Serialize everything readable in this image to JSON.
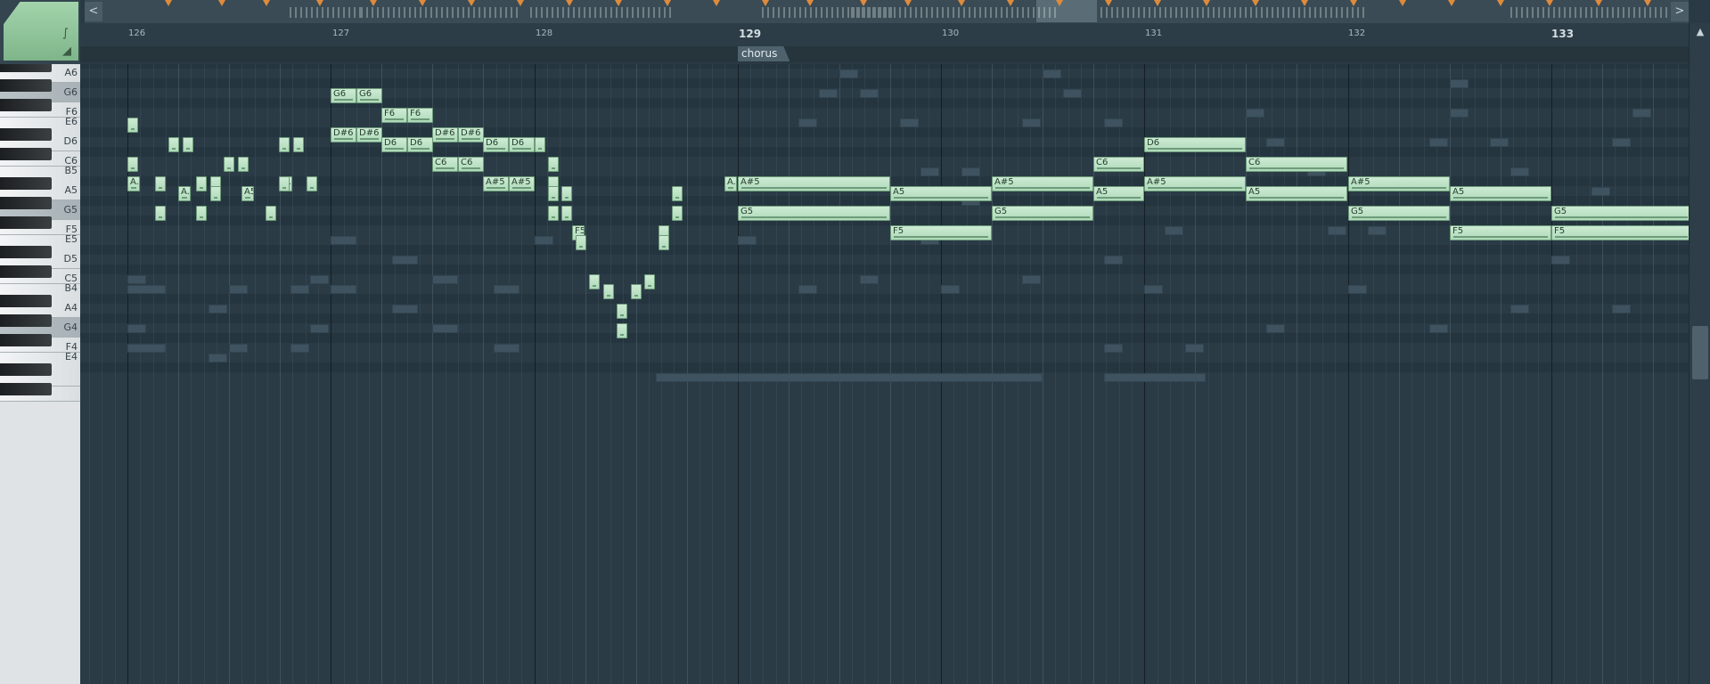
{
  "overview": {
    "left_arrow": "<",
    "right_arrow": ">"
  },
  "ruler": {
    "bars": [
      "126",
      "127",
      "128",
      "129",
      "130",
      "131",
      "132",
      "133"
    ]
  },
  "markers": [
    {
      "label": "chorus"
    }
  ],
  "keyboard": {
    "labels": [
      "A6",
      "G6",
      "F6",
      "E6",
      "D6",
      "C6",
      "B5",
      "A5",
      "G5",
      "F5",
      "E5",
      "D5",
      "C5",
      "B4",
      "A4",
      "G4",
      "F4",
      "E4"
    ]
  },
  "notes": [
    {
      "label": "G6"
    },
    {
      "label": "G6"
    },
    {
      "label": "F6"
    },
    {
      "label": "F6"
    },
    {
      "label": "D#6"
    },
    {
      "label": "D#6"
    },
    {
      "label": "D#6"
    },
    {
      "label": "D#6"
    },
    {
      "label": "D6"
    },
    {
      "label": "D6"
    },
    {
      "label": "D6"
    },
    {
      "label": "D6"
    },
    {
      "label": "D6"
    },
    {
      "label": "C6"
    },
    {
      "label": "C6"
    },
    {
      "label": "C6"
    },
    {
      "label": "C6"
    },
    {
      "label": "A#5"
    },
    {
      "label": "A#5"
    },
    {
      "label": "A#5"
    },
    {
      "label": "A#5"
    },
    {
      "label": "A#5"
    },
    {
      "label": "A#5"
    },
    {
      "label": "A."
    },
    {
      "label": "A."
    },
    {
      "label": "A."
    },
    {
      "label": "A5"
    },
    {
      "label": "A5"
    },
    {
      "label": "A5"
    },
    {
      "label": "A5"
    },
    {
      "label": "A5"
    },
    {
      "label": "A."
    },
    {
      "label": "G5"
    },
    {
      "label": "G5"
    },
    {
      "label": "G5"
    },
    {
      "label": "G5"
    },
    {
      "label": "F5"
    },
    {
      "label": "F5"
    },
    {
      "label": "F5"
    },
    {
      "label": "F5"
    }
  ],
  "colors": {
    "note_fill": "#bfe3c6",
    "grid_bg": "#2a3b46",
    "ghost": "#3e5260",
    "accent_tab": "#8fc59a"
  }
}
